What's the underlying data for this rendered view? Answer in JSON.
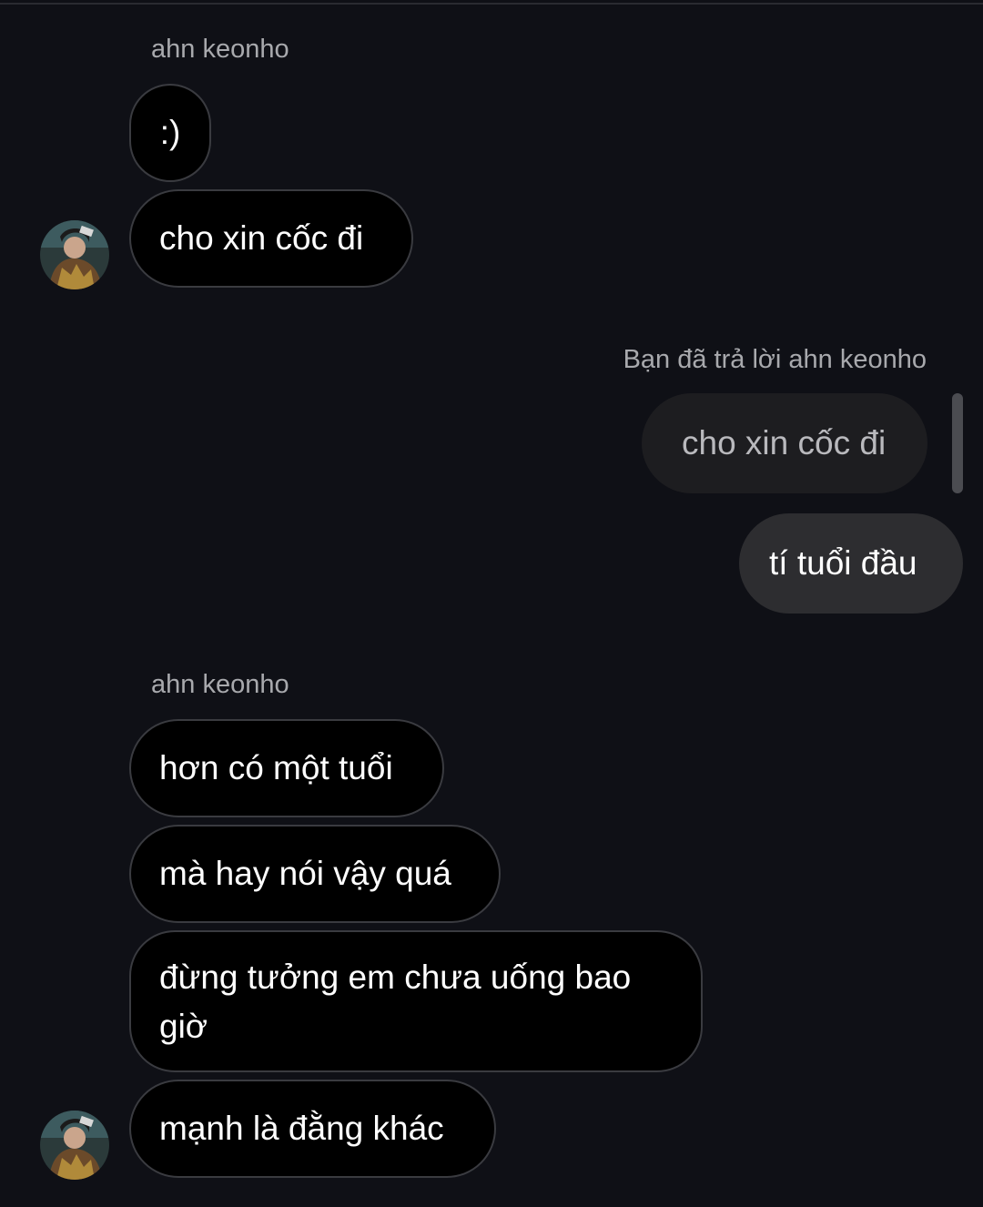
{
  "thread": {
    "sender_name_1": "ahn keonho",
    "group1": [
      {
        "text": ":)"
      },
      {
        "text": "cho xin cốc đi"
      }
    ],
    "reply_label": "Bạn đã trả lời ahn keonho",
    "quoted_text": "cho xin cốc đi",
    "outgoing": "tí tuổi đầu",
    "sender_name_2": "ahn keonho",
    "group2": [
      {
        "text": "hơn có một tuổi"
      },
      {
        "text": "mà hay nói vậy quá"
      },
      {
        "text": "đừng tưởng em chưa uống bao giờ"
      },
      {
        "text": "mạnh là đằng khác"
      }
    ]
  },
  "colors": {
    "background": "#0f1016",
    "incoming_bubble": "#000000",
    "outgoing_bubble": "#2d2d30",
    "quoted_bubble": "#1d1d20",
    "meta_text": "#a8a9ad"
  },
  "icons": {
    "avatar": "user-avatar-photo"
  }
}
